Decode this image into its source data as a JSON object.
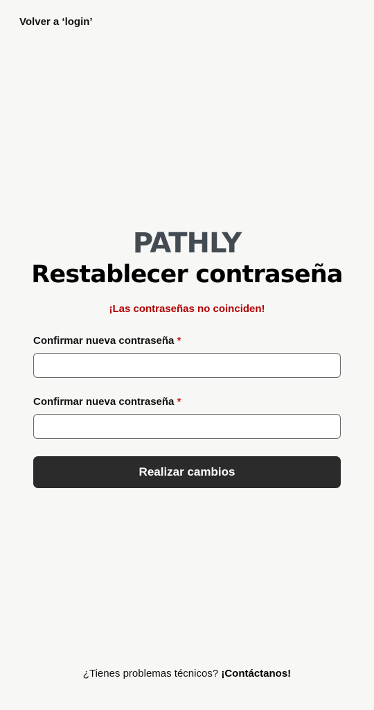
{
  "nav": {
    "back_label": "Volver a ‘login’"
  },
  "brand": {
    "name": "PATHLY"
  },
  "page": {
    "title": "Restablecer contraseña",
    "error": "¡Las contraseñas no coinciden!"
  },
  "form": {
    "fields": [
      {
        "label": "Confirmar nueva contraseña",
        "required_mark": "*",
        "value": ""
      },
      {
        "label": "Confirmar nueva contraseña",
        "required_mark": "*",
        "value": ""
      }
    ],
    "submit_label": "Realizar cambios"
  },
  "footer": {
    "question": "¿Tienes problemas técnicos?",
    "contact_label": "¡Contáctanos!"
  },
  "colors": {
    "background": "#f7f7f5",
    "brand": "#434b52",
    "error": "#b00000",
    "required": "#d11a1a",
    "button": "#2b2b2b"
  }
}
